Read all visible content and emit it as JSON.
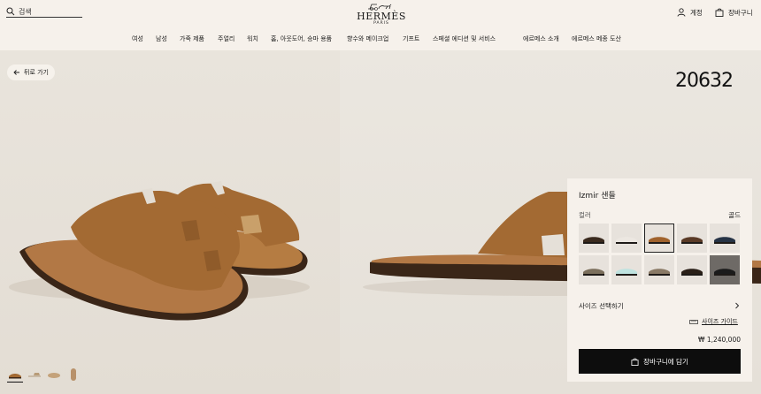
{
  "header": {
    "search_label": "검색",
    "logo_name": "HERMÈS",
    "logo_city": "PARIS",
    "account_label": "계정",
    "cart_label": "장바구니"
  },
  "nav": [
    "여성",
    "남성",
    "가죽 제품",
    "주얼리",
    "워치",
    "홈, 아웃도어, 승마 용품",
    "향수와 메이크업",
    "기프트",
    "스페셜 에디션 및 서비스",
    "에르메스 소개",
    "에르메스 메종 도산"
  ],
  "page": {
    "back_label": "뒤로 가기",
    "overlay_number": "20632"
  },
  "product": {
    "title": "Izmir 샌들",
    "color_label": "컬러",
    "color_value": "골드",
    "swatch_colors": [
      "#3a2a1e",
      "#ece7e1",
      "#a0622c",
      "#5a3a26",
      "#263345",
      "#7b6f5c",
      "#bfe3e0",
      "#8a7a66",
      "#2a2018",
      "#1b1b1b"
    ],
    "size_label": "사이즈 선택하기",
    "size_guide_label": "사이즈 가이드",
    "price": "₩ 1,240,000",
    "add_to_cart_label": "장바구니에 담기"
  },
  "colors": {
    "leather": "#a36a33",
    "sole": "#3a2618",
    "button": "#0d0d0d",
    "background": "#f6f1eb"
  }
}
